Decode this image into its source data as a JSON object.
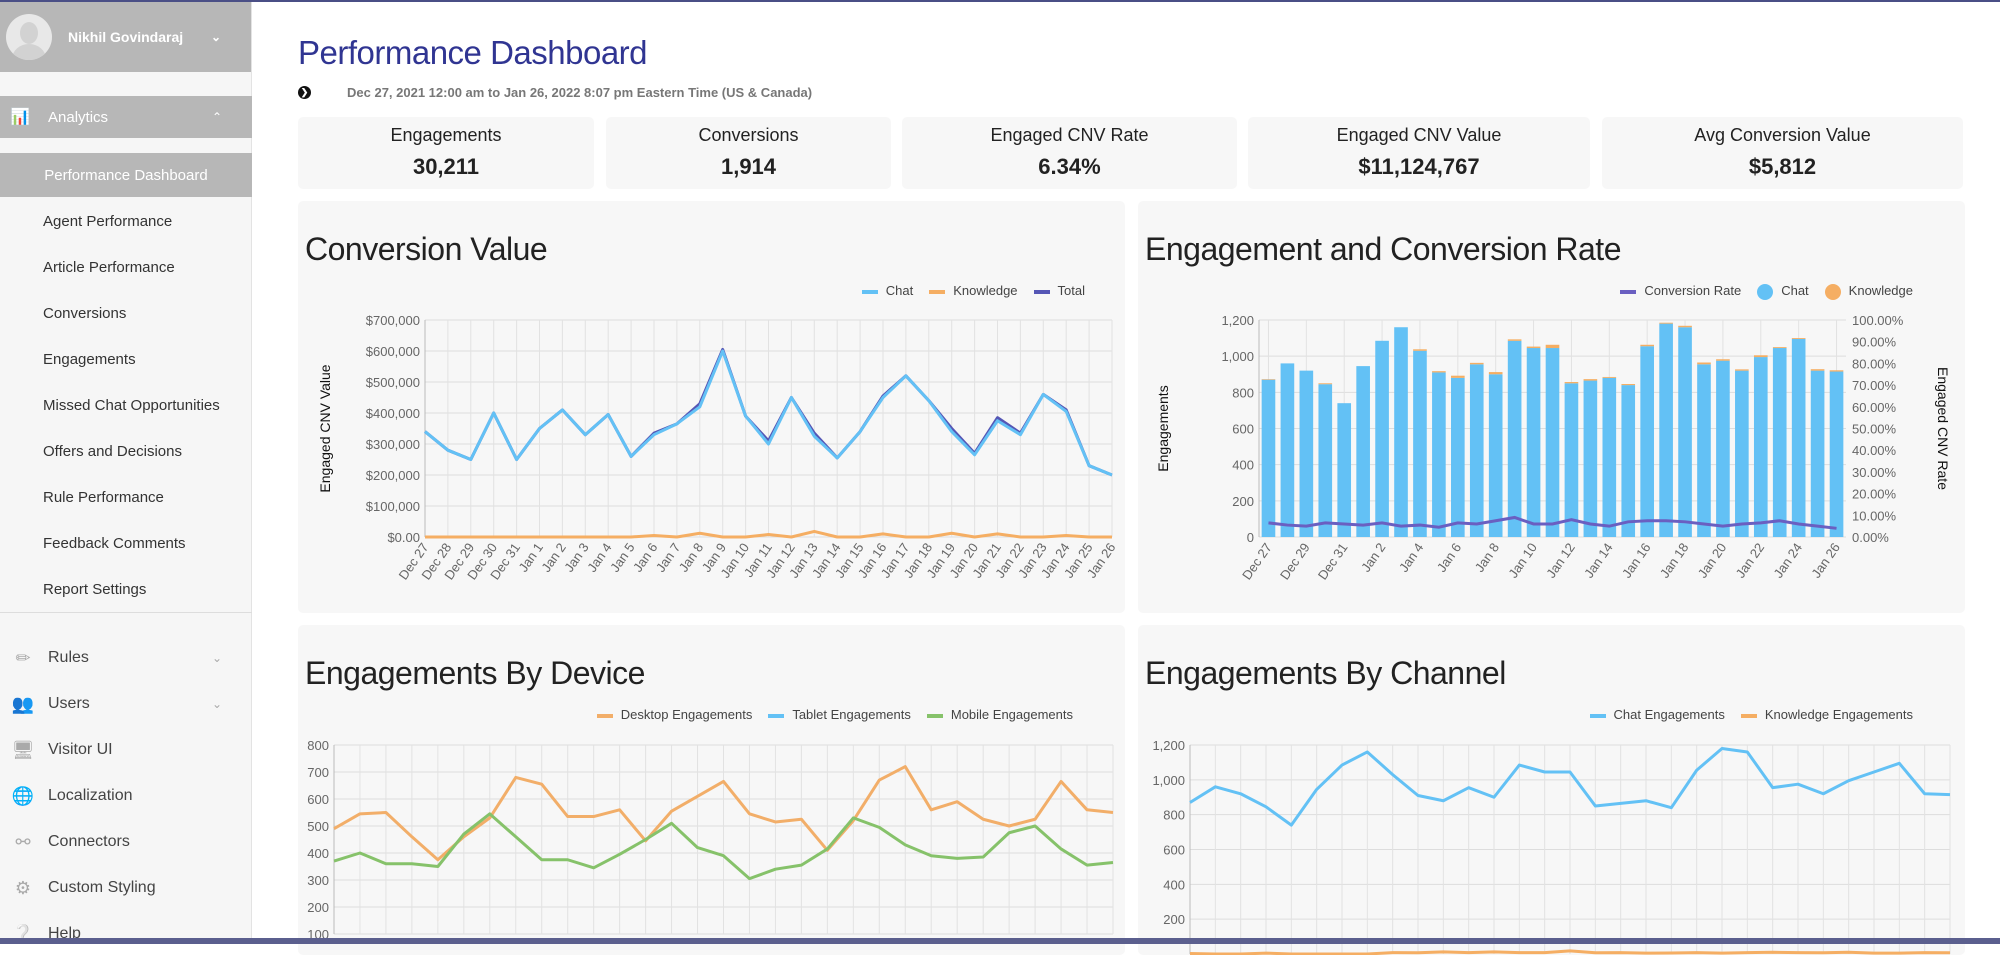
{
  "user": {
    "name": "Nikhil Govindaraj"
  },
  "sidebar": {
    "section": {
      "label": "Analytics",
      "icon": "chart-icon"
    },
    "sub_items": [
      "Performance Dashboard",
      "Agent Performance",
      "Article Performance",
      "Conversions",
      "Engagements",
      "Missed Chat Opportunities",
      "Offers and Decisions",
      "Rule Performance",
      "Feedback Comments",
      "Report Settings"
    ],
    "active_sub": "Performance Dashboard",
    "nav": [
      {
        "label": "Rules",
        "icon": "ruler-icon",
        "expandable": true
      },
      {
        "label": "Users",
        "icon": "users-icon",
        "expandable": true
      },
      {
        "label": "Visitor UI",
        "icon": "monitor-icon",
        "expandable": false
      },
      {
        "label": "Localization",
        "icon": "globe-icon",
        "expandable": false
      },
      {
        "label": "Connectors",
        "icon": "connectors-icon",
        "expandable": false
      },
      {
        "label": "Custom Styling",
        "icon": "gear-icon",
        "expandable": false
      },
      {
        "label": "Help",
        "icon": "help-icon",
        "expandable": false
      }
    ]
  },
  "header": {
    "title": "Performance Dashboard",
    "date_range": "Dec 27, 2021 12:00 am to Jan 26, 2022 8:07 pm Eastern Time (US & Canada)"
  },
  "kpis": [
    {
      "label": "Engagements",
      "value": "30,211"
    },
    {
      "label": "Conversions",
      "value": "1,914"
    },
    {
      "label": "Engaged CNV Rate",
      "value": "6.34%"
    },
    {
      "label": "Engaged CNV Value",
      "value": "$11,124,767"
    },
    {
      "label": "Avg Conversion Value",
      "value": "$5,812"
    }
  ],
  "colors": {
    "chat": "#63c1f5",
    "knowledge": "#f5ae63",
    "total": "#5556b5",
    "rate": "#6a5fc1",
    "desktop": "#f2ae69",
    "tablet": "#63c1f5",
    "mobile": "#86c26a",
    "title": "#303592"
  },
  "chart_data": [
    {
      "type": "line",
      "title": "Conversion Value",
      "ylabel": "Engaged CNV Value",
      "ylim": [
        0,
        700000
      ],
      "yticks": [
        "$0.00",
        "$100,000",
        "$200,000",
        "$300,000",
        "$400,000",
        "$500,000",
        "$600,000",
        "$700,000"
      ],
      "categories": [
        "Dec 27",
        "Dec 28",
        "Dec 29",
        "Dec 30",
        "Dec 31",
        "Jan 1",
        "Jan 2",
        "Jan 3",
        "Jan 4",
        "Jan 5",
        "Jan 6",
        "Jan 7",
        "Jan 8",
        "Jan 9",
        "Jan 10",
        "Jan 11",
        "Jan 12",
        "Jan 13",
        "Jan 14",
        "Jan 15",
        "Jan 16",
        "Jan 17",
        "Jan 18",
        "Jan 19",
        "Jan 20",
        "Jan 21",
        "Jan 22",
        "Jan 23",
        "Jan 24",
        "Jan 25",
        "Jan 26"
      ],
      "legend": "top-right",
      "grid": true,
      "series": [
        {
          "name": "Total",
          "values": [
            340000,
            280000,
            250000,
            400000,
            250000,
            350000,
            410000,
            330000,
            395000,
            260000,
            335000,
            365000,
            430000,
            605000,
            390000,
            310000,
            450000,
            335000,
            255000,
            340000,
            455000,
            520000,
            440000,
            350000,
            270000,
            385000,
            335000,
            460000,
            410000,
            230000,
            200000
          ]
        },
        {
          "name": "Chat",
          "values": [
            340000,
            280000,
            250000,
            400000,
            250000,
            350000,
            410000,
            330000,
            395000,
            260000,
            330000,
            365000,
            420000,
            600000,
            390000,
            300000,
            450000,
            325000,
            255000,
            340000,
            450000,
            520000,
            440000,
            340000,
            265000,
            375000,
            330000,
            460000,
            405000,
            230000,
            200000
          ]
        },
        {
          "name": "Knowledge",
          "values": [
            0,
            0,
            0,
            0,
            0,
            0,
            0,
            0,
            0,
            0,
            5000,
            0,
            12000,
            0,
            0,
            8000,
            0,
            18000,
            0,
            0,
            10000,
            0,
            0,
            12000,
            0,
            10000,
            0,
            0,
            5000,
            0,
            0
          ]
        }
      ]
    },
    {
      "type": "bar",
      "title": "Engagement and Conversion Rate",
      "ylabel": "Engagements",
      "y2label": "Engaged CNV Rate",
      "ylim": [
        0,
        1200
      ],
      "y2lim": [
        0,
        100
      ],
      "yticks": [
        "0",
        "200",
        "400",
        "600",
        "800",
        "1,000",
        "1,200"
      ],
      "y2ticks": [
        "0.00%",
        "10.00%",
        "20.00%",
        "30.00%",
        "40.00%",
        "50.00%",
        "60.00%",
        "70.00%",
        "80.00%",
        "90.00%",
        "100.00%"
      ],
      "categories": [
        "Dec 27",
        "Dec 28",
        "Dec 29",
        "Dec 30",
        "Dec 31",
        "Jan 1",
        "Jan 2",
        "Jan 3",
        "Jan 4",
        "Jan 5",
        "Jan 6",
        "Jan 7",
        "Jan 8",
        "Jan 9",
        "Jan 10",
        "Jan 11",
        "Jan 12",
        "Jan 13",
        "Jan 14",
        "Jan 15",
        "Jan 16",
        "Jan 17",
        "Jan 18",
        "Jan 19",
        "Jan 20",
        "Jan 21",
        "Jan 22",
        "Jan 23",
        "Jan 24",
        "Jan 25",
        "Jan 26"
      ],
      "xtick_labels": [
        "Dec 27",
        "Dec 29",
        "Dec 31",
        "Jan 2",
        "Jan 4",
        "Jan 6",
        "Jan 8",
        "Jan 10",
        "Jan 12",
        "Jan 14",
        "Jan 16",
        "Jan 18",
        "Jan 20",
        "Jan 22",
        "Jan 24",
        "Jan 26"
      ],
      "legend": "top-right",
      "stacked": true,
      "series": [
        {
          "name": "Chat",
          "values": [
            870,
            960,
            920,
            845,
            740,
            945,
            1085,
            1160,
            1030,
            910,
            880,
            955,
            900,
            1085,
            1045,
            1045,
            850,
            865,
            880,
            840,
            1055,
            1180,
            1160,
            955,
            975,
            920,
            995,
            1045,
            1095,
            920,
            915
          ]
        },
        {
          "name": "Knowledge",
          "values": [
            3,
            0,
            0,
            5,
            0,
            0,
            0,
            0,
            8,
            7,
            12,
            8,
            12,
            8,
            8,
            18,
            7,
            8,
            5,
            6,
            8,
            5,
            8,
            10,
            8,
            7,
            10,
            5,
            5,
            8,
            7
          ]
        },
        {
          "name": "Conversion Rate",
          "axis": "right",
          "values": [
            6.5,
            5.5,
            5,
            6.5,
            6,
            5.5,
            6.5,
            5,
            5.5,
            4.5,
            6.5,
            6,
            7.5,
            9,
            6,
            6,
            8,
            6,
            5,
            7,
            7.5,
            7.5,
            7,
            6,
            5,
            6,
            6.5,
            7.5,
            6,
            5,
            4
          ]
        }
      ]
    },
    {
      "type": "line",
      "title": "Engagements By Device",
      "ylim": [
        100,
        800
      ],
      "yticks": [
        "100",
        "200",
        "300",
        "400",
        "500",
        "600",
        "700",
        "800"
      ],
      "legend": "top-right",
      "grid": true,
      "series": [
        {
          "name": "Desktop Engagements",
          "values": [
            490,
            545,
            550,
            460,
            375,
            460,
            530,
            680,
            655,
            535,
            535,
            560,
            445,
            555,
            610,
            665,
            545,
            515,
            525,
            410,
            520,
            670,
            720,
            560,
            590,
            525,
            500,
            525,
            665,
            560,
            550
          ]
        },
        {
          "name": "Tablet Engagements",
          "values": []
        },
        {
          "name": "Mobile Engagements",
          "values": [
            370,
            400,
            360,
            360,
            350,
            470,
            545,
            460,
            375,
            375,
            345,
            395,
            450,
            510,
            420,
            390,
            305,
            340,
            355,
            415,
            530,
            495,
            430,
            390,
            380,
            385,
            475,
            500,
            415,
            355,
            365
          ]
        }
      ]
    },
    {
      "type": "line",
      "title": "Engagements By Channel",
      "ylim": [
        0,
        1200
      ],
      "yticks": [
        "200",
        "400",
        "600",
        "800",
        "1,000",
        "1,200"
      ],
      "legend": "top-right",
      "grid": true,
      "series": [
        {
          "name": "Chat Engagements",
          "values": [
            870,
            960,
            920,
            845,
            740,
            945,
            1085,
            1160,
            1030,
            910,
            880,
            955,
            900,
            1085,
            1045,
            1045,
            850,
            865,
            880,
            840,
            1055,
            1180,
            1160,
            955,
            975,
            920,
            995,
            1045,
            1095,
            920,
            915
          ]
        },
        {
          "name": "Knowledge Engagements",
          "values": [
            3,
            0,
            0,
            5,
            0,
            0,
            0,
            0,
            8,
            7,
            12,
            8,
            12,
            8,
            8,
            18,
            7,
            8,
            5,
            6,
            8,
            5,
            8,
            10,
            8,
            7,
            10,
            5,
            5,
            8,
            7
          ]
        }
      ]
    }
  ]
}
